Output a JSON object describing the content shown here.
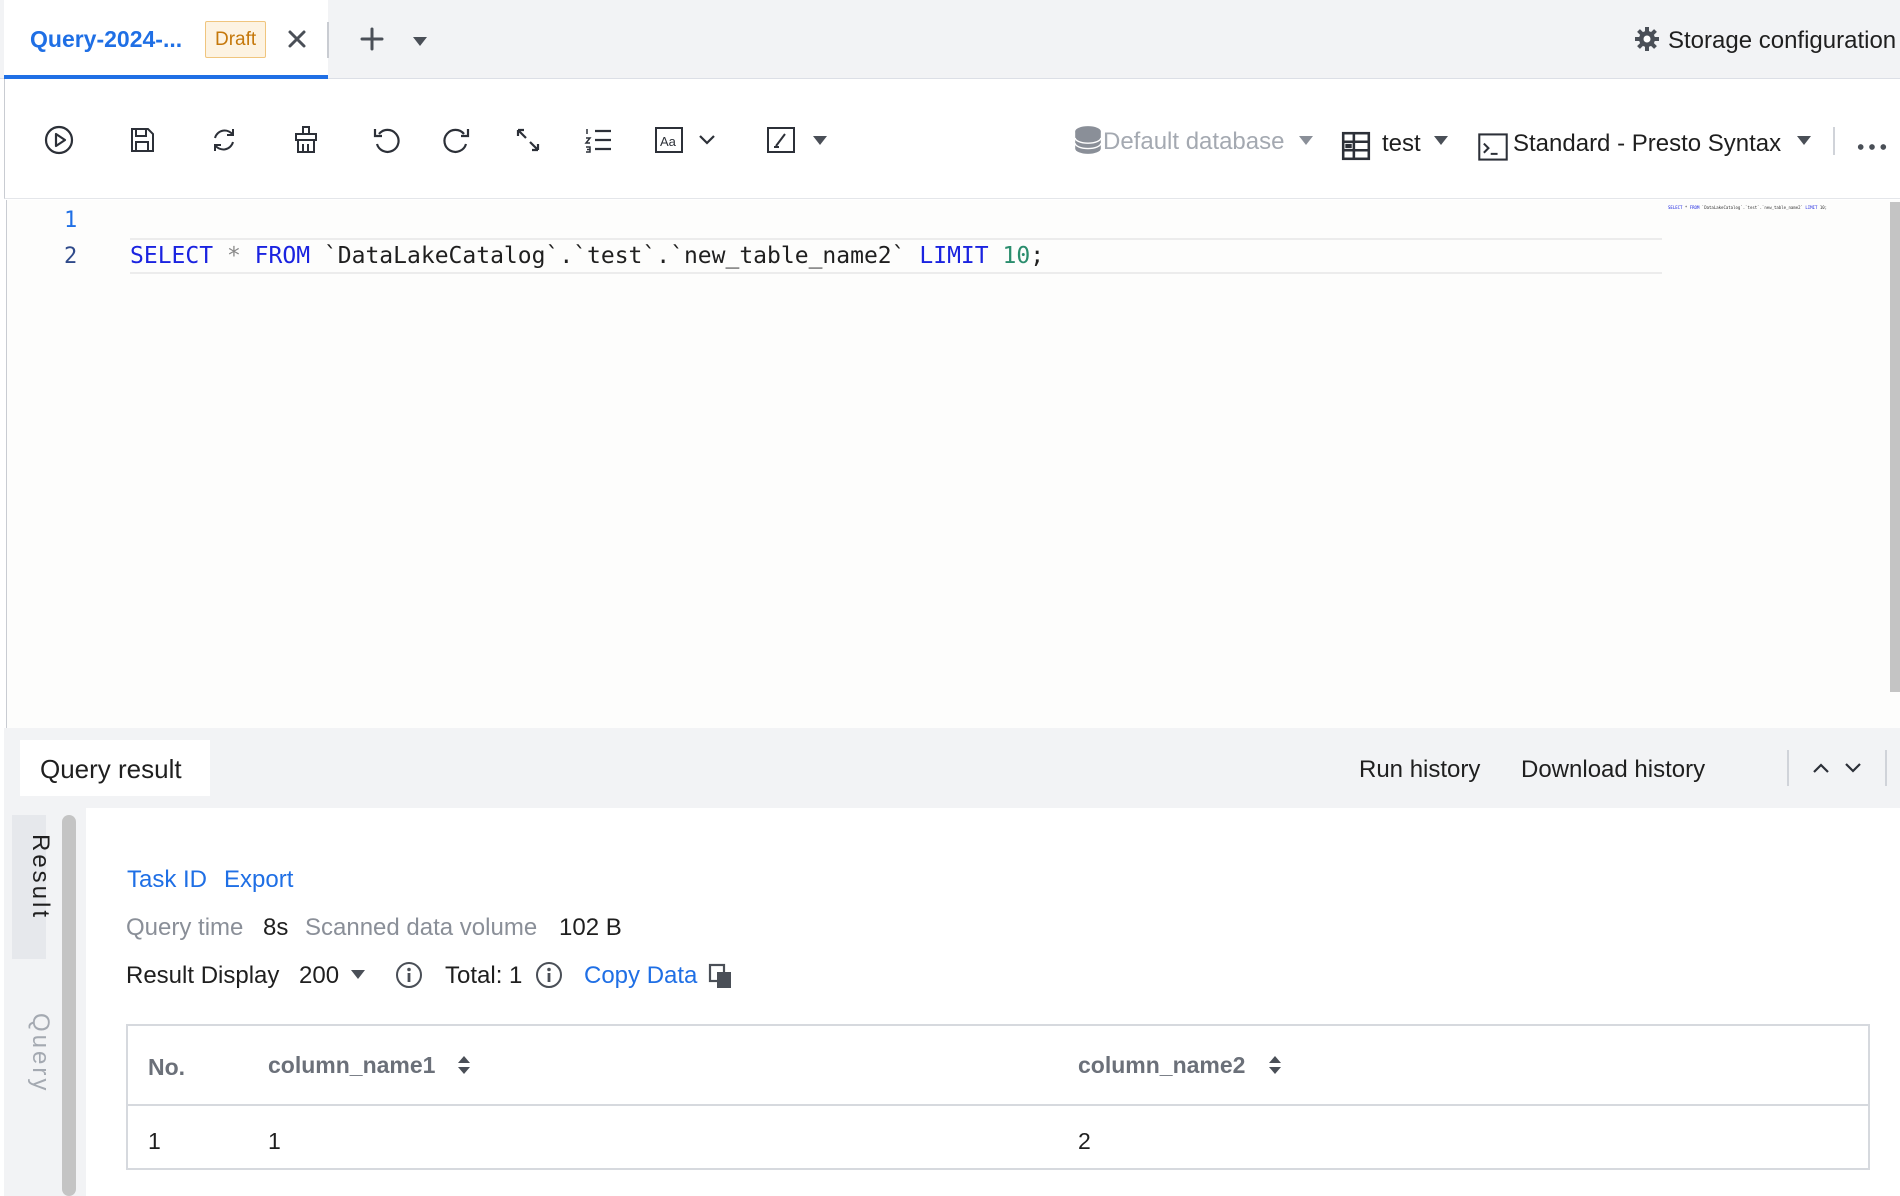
{
  "tabs": [
    {
      "title": "Query-2024-...",
      "badge": "Draft"
    }
  ],
  "header": {
    "storage_label": "Storage configuration"
  },
  "toolbar": {
    "database_placeholder": "Default database",
    "table_value": "test",
    "syntax_value": "Standard - Presto Syntax",
    "icons": [
      "run-icon",
      "save-icon",
      "refresh-icon",
      "clear-icon",
      "undo-icon",
      "redo-icon",
      "expand-icon",
      "format-list-icon",
      "font-size-icon",
      "chevron-down-icon",
      "code-snippet-icon",
      "caret-down-icon",
      "database-icon",
      "table-icon",
      "terminal-icon",
      "more-icon"
    ]
  },
  "editor": {
    "line_numbers": [
      "1",
      "2"
    ],
    "code": {
      "kw_select": "SELECT",
      "star": "*",
      "kw_from": "FROM",
      "identifier": "`DataLakeCatalog`.`test`.`new_table_name2`",
      "kw_limit": "LIMIT",
      "number": "10",
      "terminator": ";"
    }
  },
  "result_header": {
    "active_tab": "Query result",
    "run_history": "Run history",
    "download_history": "Download history"
  },
  "side_rail": {
    "result": "Result",
    "query": "Query"
  },
  "result": {
    "task_id": "Task ID",
    "export": "Export",
    "query_time_label": "Query time",
    "query_time_value": "8s",
    "scanned_label": "Scanned data volume",
    "scanned_value": "102 B",
    "display_label": "Result Display",
    "display_value": "200",
    "total_label": "Total: 1",
    "copy_data": "Copy Data"
  },
  "table": {
    "columns": [
      "No.",
      "column_name1",
      "column_name2"
    ],
    "rows": [
      [
        "1",
        "1",
        "2"
      ]
    ]
  },
  "colors": {
    "accent": "#1f6fe5",
    "keyword": "#1a23e0",
    "number": "#2a8d6d",
    "badge": "#c5780b"
  }
}
